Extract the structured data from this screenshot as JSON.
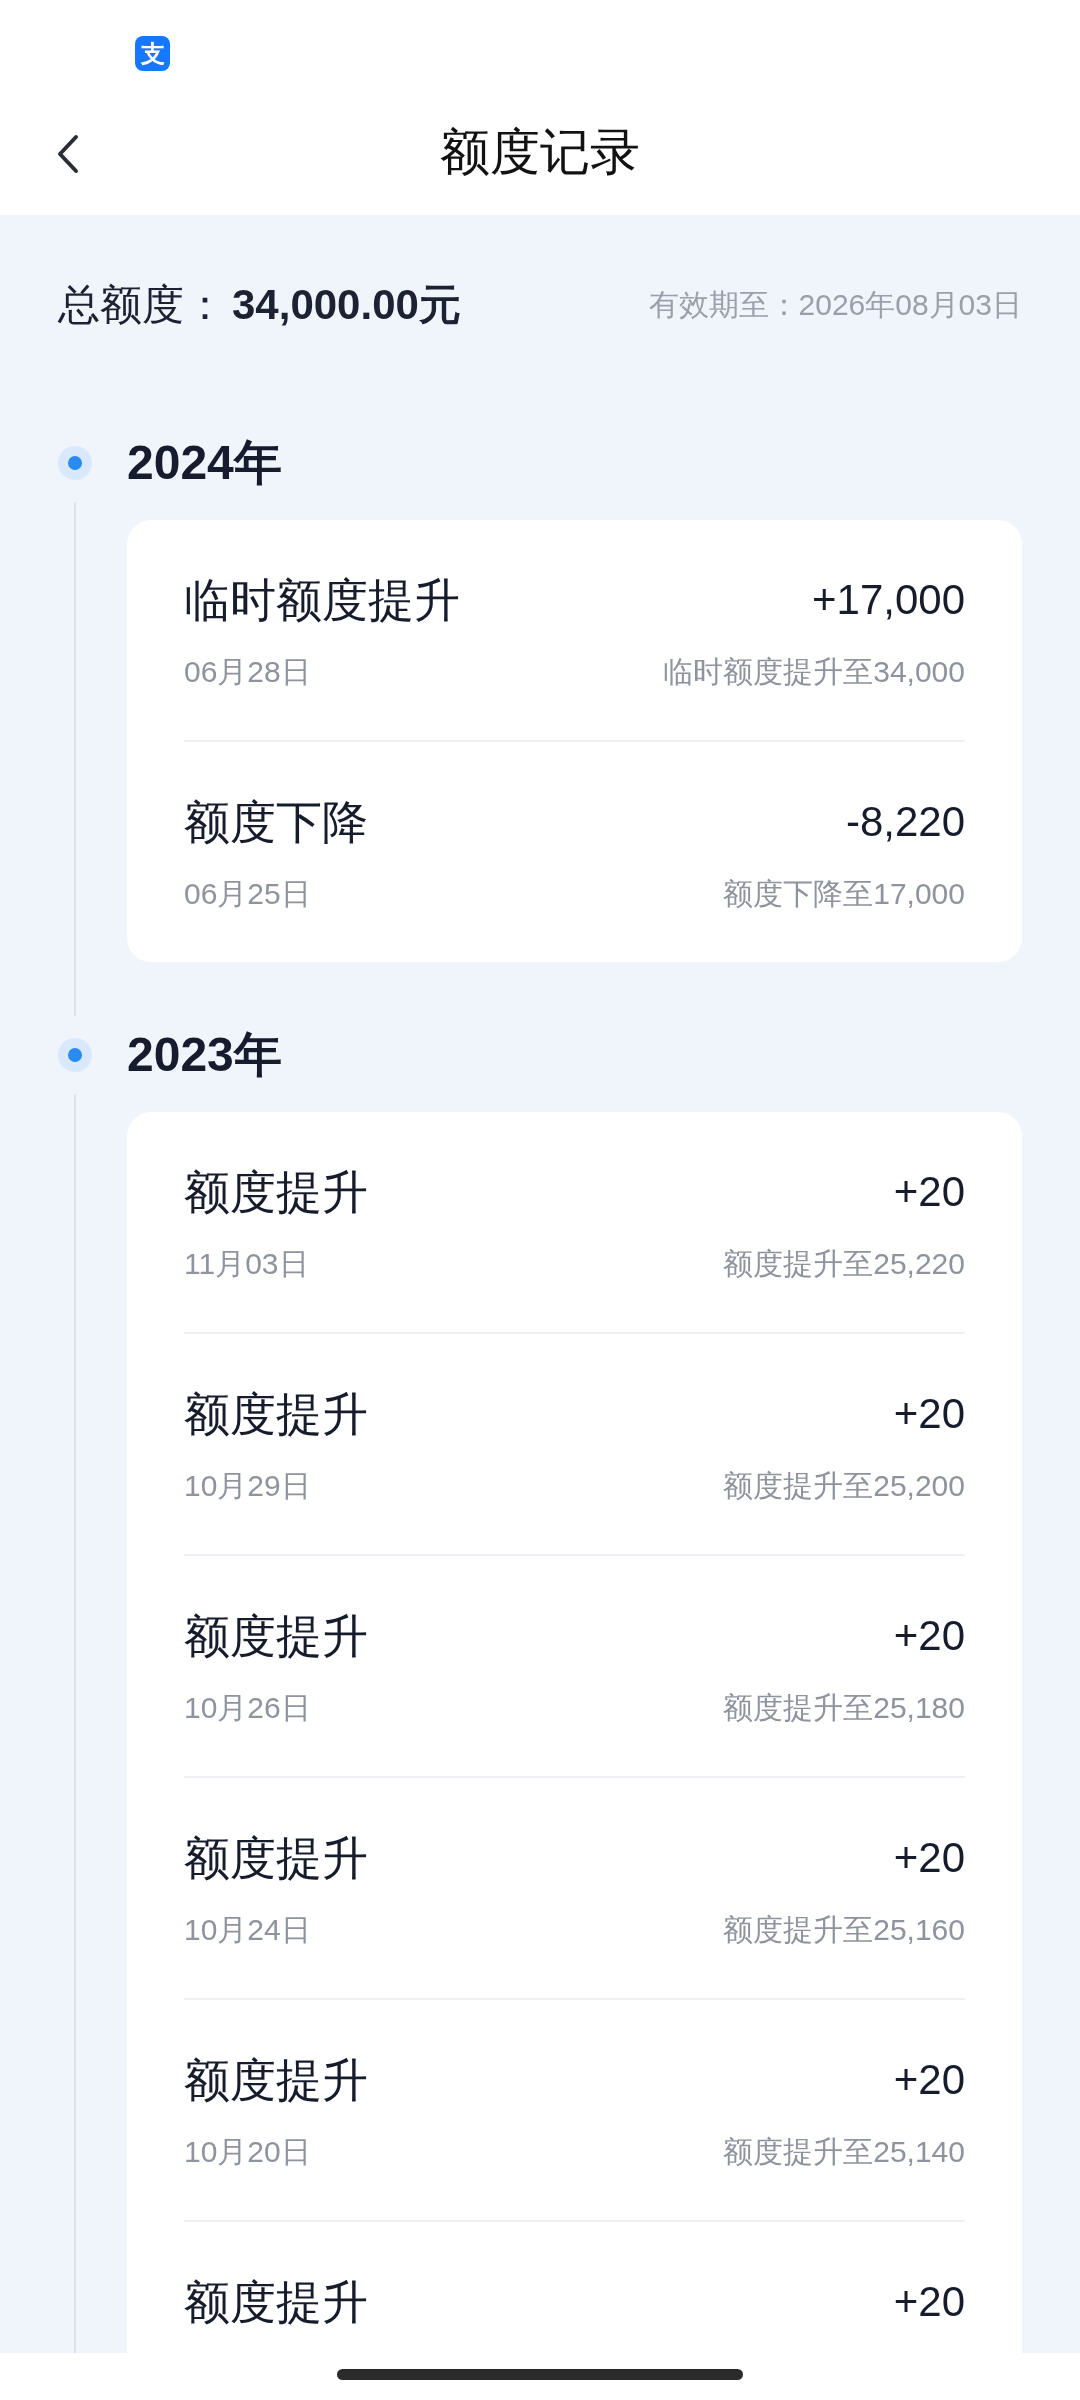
{
  "status_bar": {
    "app_icon_text": "支"
  },
  "header": {
    "title": "额度记录"
  },
  "summary": {
    "label": "总额度：",
    "amount": "34,000.00元",
    "validity": "有效期至：2026年08月03日"
  },
  "years": [
    {
      "year": "2024年",
      "records": [
        {
          "title": "临时额度提升",
          "amount": "+17,000",
          "date": "06月28日",
          "note": "临时额度提升至34,000"
        },
        {
          "title": "额度下降",
          "amount": "-8,220",
          "date": "06月25日",
          "note": "额度下降至17,000"
        }
      ]
    },
    {
      "year": "2023年",
      "records": [
        {
          "title": "额度提升",
          "amount": "+20",
          "date": "11月03日",
          "note": "额度提升至25,220"
        },
        {
          "title": "额度提升",
          "amount": "+20",
          "date": "10月29日",
          "note": "额度提升至25,200"
        },
        {
          "title": "额度提升",
          "amount": "+20",
          "date": "10月26日",
          "note": "额度提升至25,180"
        },
        {
          "title": "额度提升",
          "amount": "+20",
          "date": "10月24日",
          "note": "额度提升至25,160"
        },
        {
          "title": "额度提升",
          "amount": "+20",
          "date": "10月20日",
          "note": "额度提升至25,140"
        },
        {
          "title": "额度提升",
          "amount": "+20"
        }
      ]
    }
  ]
}
